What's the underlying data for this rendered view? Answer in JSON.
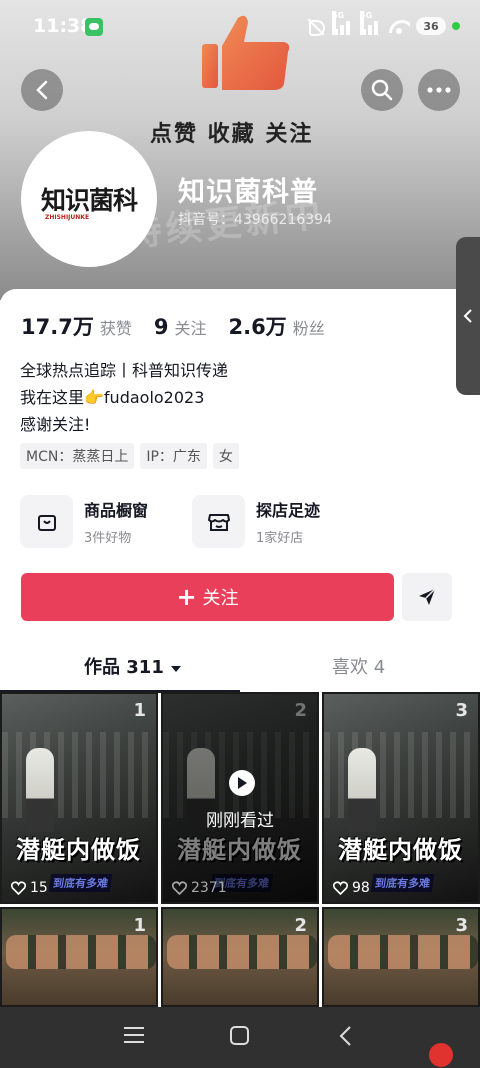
{
  "status_bar": {
    "time": "11:38",
    "network_1": "5G",
    "network_2": "5G",
    "battery": "36"
  },
  "header": {
    "banner_text": "点赞 收藏 关注",
    "banner_watermark": "持续更新中",
    "avatar_logo": "知识菌科",
    "avatar_sub": "ZHISHIJUNKE",
    "nickname": "知识菌科普",
    "douyin_id": "抖音号：43966216394"
  },
  "stats": [
    {
      "num": "17.7万",
      "label": "获赞"
    },
    {
      "num": "9",
      "label": "关注"
    },
    {
      "num": "2.6万",
      "label": "粉丝"
    }
  ],
  "bio": {
    "line1": "全球热点追踪丨科普知识传递",
    "line2": "我在这里👉fudaolo2023",
    "line3": "感谢关注!"
  },
  "tags": [
    "MCN：蒸蒸日上",
    "IP：广东",
    "女"
  ],
  "shop": [
    {
      "title": "商品橱窗",
      "sub": "3件好物",
      "icon": "bag-icon"
    },
    {
      "title": "探店足迹",
      "sub": "1家好店",
      "icon": "store-icon"
    }
  ],
  "follow": {
    "plus": "+",
    "label": "关注"
  },
  "tabs": {
    "works": "作品 311",
    "likes": "喜欢 4"
  },
  "videos": [
    {
      "num": "1",
      "caption": "潜艇内做饭",
      "sub": "到底有多难",
      "likes": "15"
    },
    {
      "num": "2",
      "caption": "潜艇内做饭",
      "sub": "到底有多难",
      "likes": "2371",
      "watched": "刚刚看过"
    },
    {
      "num": "3",
      "caption": "潜艇内做饭",
      "sub": "到底有多难",
      "likes": "98"
    },
    {
      "num": "1"
    },
    {
      "num": "2"
    },
    {
      "num": "3"
    }
  ],
  "colors": {
    "follow_button": "#ea3f5a",
    "nav_bar": "#303030",
    "record_dot": "#e0322f"
  }
}
